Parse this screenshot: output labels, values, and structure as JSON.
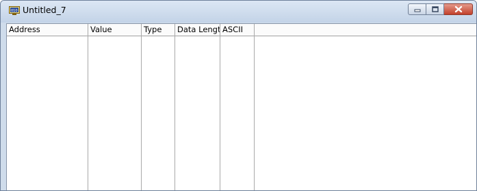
{
  "window": {
    "title": "Untitled_7",
    "icon": "monitor-icon",
    "controls": [
      "minimize-icon",
      "maximize-icon",
      "close-icon"
    ],
    "colors": {
      "titlebar": "#cfdceb",
      "close": "#c94a35"
    }
  },
  "table": {
    "columns": [
      "Address",
      "Value",
      "Type",
      "Data Length",
      "ASCII",
      ""
    ],
    "rows": []
  }
}
